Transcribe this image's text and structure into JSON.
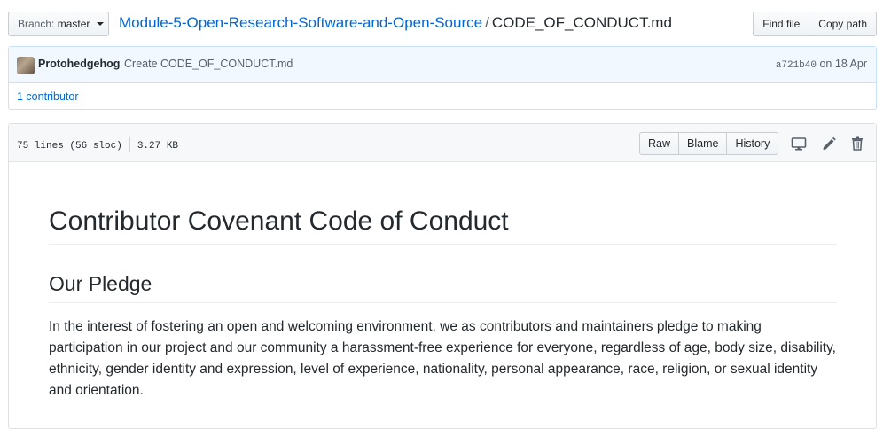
{
  "topbar": {
    "branch_prefix": "Branch:",
    "branch_name": "master",
    "repo": "Module-5-Open-Research-Software-and-Open-Source",
    "separator": "/",
    "file": "CODE_OF_CONDUCT.md",
    "find_file": "Find file",
    "copy_path": "Copy path"
  },
  "commit": {
    "author": "Protohedgehog",
    "message": "Create CODE_OF_CONDUCT.md",
    "sha": "a721b40",
    "date": "on 18 Apr",
    "contributors": "1 contributor"
  },
  "file": {
    "lines": "75 lines (56 sloc)",
    "size": "3.27 KB",
    "raw": "Raw",
    "blame": "Blame",
    "history": "History",
    "icons": [
      "desktop-icon",
      "pencil-icon",
      "trash-icon"
    ]
  },
  "markdown": {
    "title": "Contributor Covenant Code of Conduct",
    "h2": "Our Pledge",
    "paragraph": "In the interest of fostering an open and welcoming environment, we as contributors and maintainers pledge to making participation in our project and our community a harassment-free experience for everyone, regardless of age, body size, disability, ethnicity, gender identity and expression, level of experience, nationality, personal appearance, race, religion, or sexual identity and orientation."
  },
  "colors": {
    "link": "#0366d6",
    "commit_bg": "#f1f8ff",
    "commit_border": "#c8e1ff"
  }
}
